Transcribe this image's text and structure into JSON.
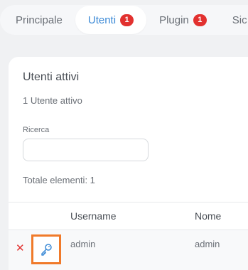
{
  "tabs": [
    {
      "label": "Principale",
      "badge": null,
      "active": false
    },
    {
      "label": "Utenti",
      "badge": "1",
      "active": true
    },
    {
      "label": "Plugin",
      "badge": "1",
      "active": false
    },
    {
      "label": "Sic",
      "badge": null,
      "active": false
    }
  ],
  "card": {
    "title": "Utenti attivi",
    "subtitle": "1 Utente attivo",
    "search_label": "Ricerca",
    "search_value": "",
    "total": "Totale elementi: 1"
  },
  "table": {
    "columns": [
      "Username",
      "Nome"
    ],
    "rows": [
      {
        "username": "admin",
        "nome": "admin"
      }
    ]
  },
  "icons": {
    "delete": "close-icon",
    "key": "key-icon"
  },
  "colors": {
    "accent": "#3c8ad6",
    "badge": "#e2312f",
    "delete": "#e2312f",
    "highlight": "#f07a2a"
  }
}
